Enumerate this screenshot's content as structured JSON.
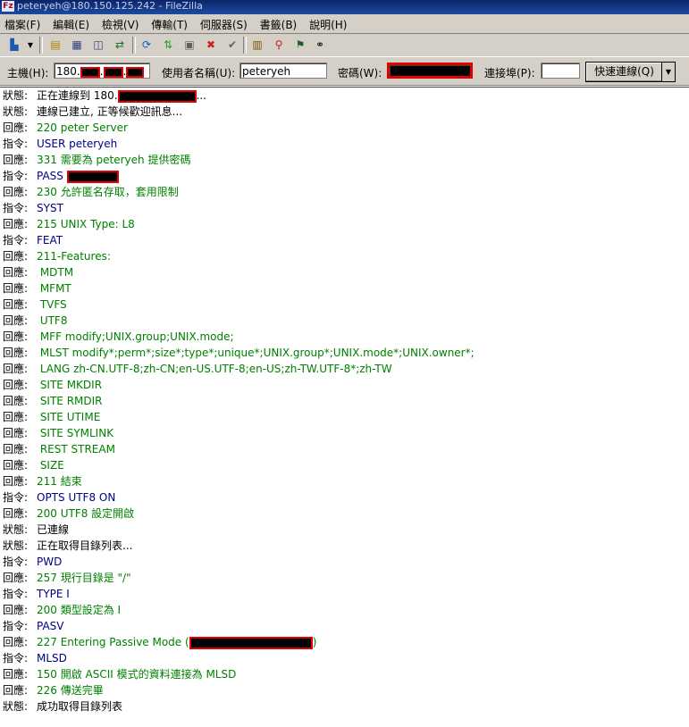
{
  "window": {
    "title": "peteryeh@180.150.125.242 - FileZilla"
  },
  "menu": [
    "檔案(F)",
    "編輯(E)",
    "檢視(V)",
    "傳輸(T)",
    "伺服器(S)",
    "書籤(B)",
    "說明(H)"
  ],
  "toolbar_icons": [
    "site-manager-icon",
    "dropdown-arrow-icon",
    "message-log-icon",
    "local-tree-icon",
    "remote-tree-icon",
    "transfer-queue-icon",
    "refresh-icon",
    "process-queue-icon",
    "cancel-icon",
    "disconnect-icon",
    "reconnect-icon",
    "directory-compare-icon",
    "sync-browse-icon",
    "filter-icon",
    "search-icon"
  ],
  "quickconnect": {
    "host_label": "主機(H):",
    "host_value": "180.",
    "user_label": "使用者名稱(U):",
    "user_value": "peteryeh",
    "pass_label": "密碼(W):",
    "port_label": "連接埠(P):",
    "port_value": "",
    "button_label": "快速連線(Q)"
  },
  "log": [
    {
      "type": "status",
      "k": "狀態:",
      "text": "正在連線到 180.",
      "tail": "..."
    },
    {
      "type": "status",
      "k": "狀態:",
      "text": "連線已建立, 正等候歡迎訊息..."
    },
    {
      "type": "resp",
      "k": "回應:",
      "text": "220 peter Server"
    },
    {
      "type": "cmd",
      "k": "指令:",
      "text": "USER peteryeh"
    },
    {
      "type": "resp",
      "k": "回應:",
      "text": "331 需要為 peteryeh 提供密碼"
    },
    {
      "type": "cmd",
      "k": "指令:",
      "text": "PASS "
    },
    {
      "type": "resp",
      "k": "回應:",
      "text": "230 允許匿名存取，套用限制"
    },
    {
      "type": "cmd",
      "k": "指令:",
      "text": "SYST"
    },
    {
      "type": "resp",
      "k": "回應:",
      "text": "215 UNIX Type: L8"
    },
    {
      "type": "cmd",
      "k": "指令:",
      "text": "FEAT"
    },
    {
      "type": "resp",
      "k": "回應:",
      "text": "211-Features:"
    },
    {
      "type": "resp",
      "k": "回應:",
      "text": " MDTM"
    },
    {
      "type": "resp",
      "k": "回應:",
      "text": " MFMT"
    },
    {
      "type": "resp",
      "k": "回應:",
      "text": " TVFS"
    },
    {
      "type": "resp",
      "k": "回應:",
      "text": " UTF8"
    },
    {
      "type": "resp",
      "k": "回應:",
      "text": " MFF modify;UNIX.group;UNIX.mode;"
    },
    {
      "type": "resp",
      "k": "回應:",
      "text": " MLST modify*;perm*;size*;type*;unique*;UNIX.group*;UNIX.mode*;UNIX.owner*;"
    },
    {
      "type": "resp",
      "k": "回應:",
      "text": " LANG zh-CN.UTF-8;zh-CN;en-US.UTF-8;en-US;zh-TW.UTF-8*;zh-TW"
    },
    {
      "type": "resp",
      "k": "回應:",
      "text": " SITE MKDIR"
    },
    {
      "type": "resp",
      "k": "回應:",
      "text": " SITE RMDIR"
    },
    {
      "type": "resp",
      "k": "回應:",
      "text": " SITE UTIME"
    },
    {
      "type": "resp",
      "k": "回應:",
      "text": " SITE SYMLINK"
    },
    {
      "type": "resp",
      "k": "回應:",
      "text": " REST STREAM"
    },
    {
      "type": "resp",
      "k": "回應:",
      "text": " SIZE"
    },
    {
      "type": "resp",
      "k": "回應:",
      "text": "211 結束"
    },
    {
      "type": "cmd",
      "k": "指令:",
      "text": "OPTS UTF8 ON"
    },
    {
      "type": "resp",
      "k": "回應:",
      "text": "200 UTF8 設定開啟"
    },
    {
      "type": "status",
      "k": "狀態:",
      "text": "已連線"
    },
    {
      "type": "status",
      "k": "狀態:",
      "text": "正在取得目錄列表..."
    },
    {
      "type": "cmd",
      "k": "指令:",
      "text": "PWD"
    },
    {
      "type": "resp",
      "k": "回應:",
      "text": "257 現行目錄是 \"/\""
    },
    {
      "type": "cmd",
      "k": "指令:",
      "text": "TYPE I"
    },
    {
      "type": "resp",
      "k": "回應:",
      "text": "200 類型設定為 I"
    },
    {
      "type": "cmd",
      "k": "指令:",
      "text": "PASV"
    },
    {
      "type": "resp",
      "k": "回應:",
      "text": "227 Entering Passive Mode (",
      "tail": ")"
    },
    {
      "type": "cmd",
      "k": "指令:",
      "text": "MLSD"
    },
    {
      "type": "resp",
      "k": "回應:",
      "text": "150 開啟 ASCII 模式的資料連接為 MLSD"
    },
    {
      "type": "resp",
      "k": "回應:",
      "text": "226 傳送完畢"
    },
    {
      "type": "status",
      "k": "狀態:",
      "text": "成功取得目錄列表"
    }
  ]
}
